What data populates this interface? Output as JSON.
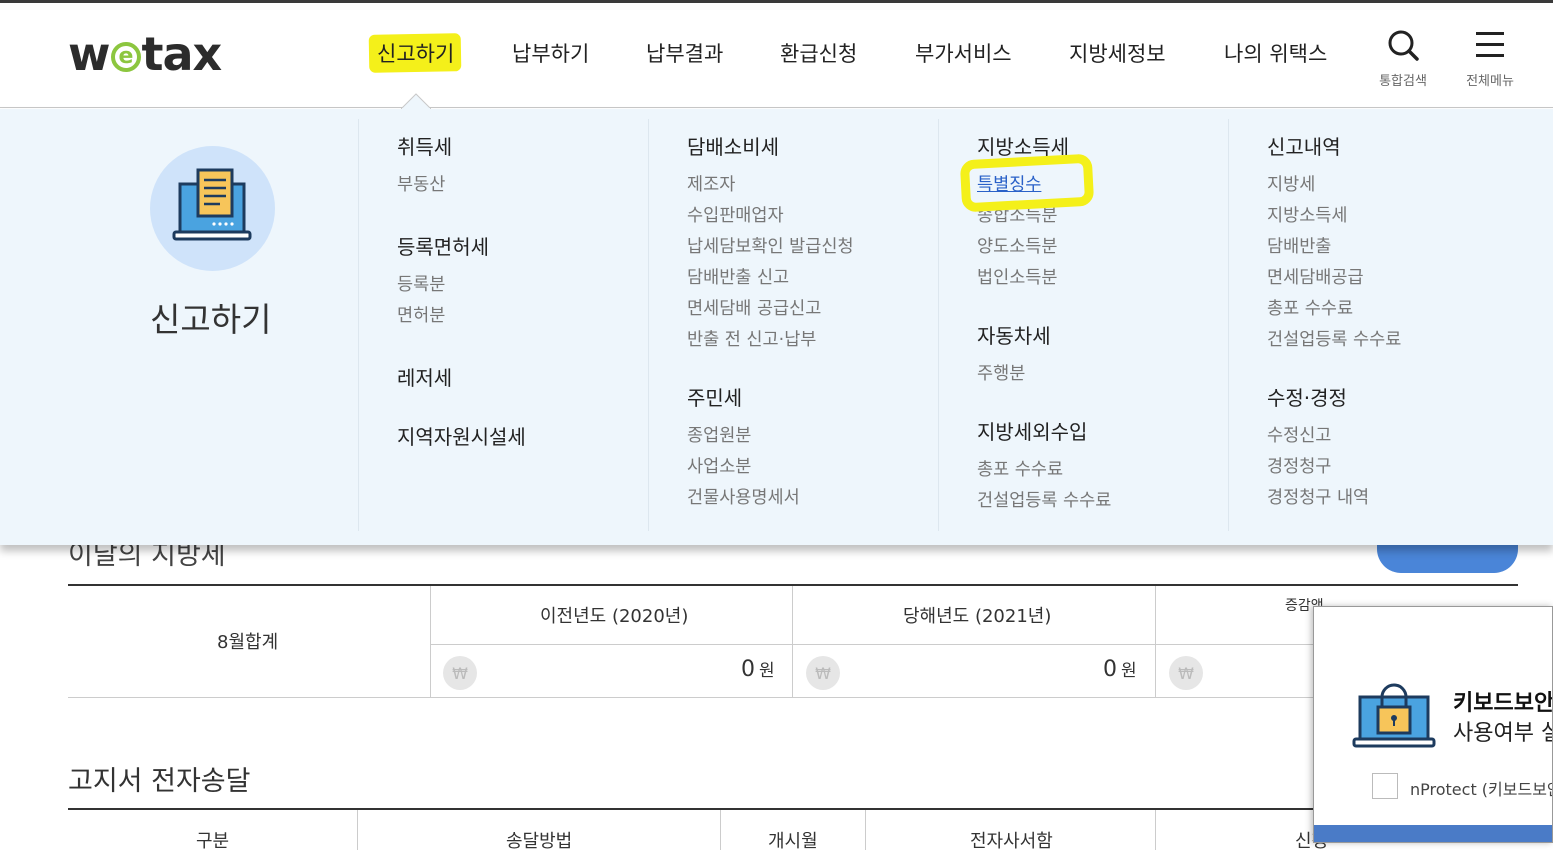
{
  "logo": {
    "w": "w",
    "e": "e",
    "rest": "tax"
  },
  "gnb": [
    {
      "label": "신고하기"
    },
    {
      "label": "납부하기"
    },
    {
      "label": "납부결과"
    },
    {
      "label": "환급신청"
    },
    {
      "label": "부가서비스"
    },
    {
      "label": "지방세정보"
    },
    {
      "label": "나의 위택스"
    }
  ],
  "util": {
    "search_label": "통합검색",
    "menu_label": "전체메뉴"
  },
  "panel": {
    "title": "신고하기",
    "col1": {
      "g1_title": "취득세",
      "g1_items": [
        "부동산"
      ],
      "g2_title": "등록면허세",
      "g2_items": [
        "등록분",
        "면허분"
      ],
      "g3_title": "레저세",
      "g4_title": "지역자원시설세"
    },
    "col2": {
      "g1_title": "담배소비세",
      "g1_items": [
        "제조자",
        "수입판매업자",
        "납세담보확인 발급신청",
        "담배반출 신고",
        "면세담배 공급신고",
        "반출 전 신고·납부"
      ],
      "g2_title": "주민세",
      "g2_items": [
        "종업원분",
        "사업소분",
        "건물사용명세서"
      ]
    },
    "col3": {
      "g1_title": "지방소득세",
      "g1_items": [
        "특별징수",
        "종합소득분",
        "양도소득분",
        "법인소득분"
      ],
      "g2_title": "자동차세",
      "g2_items": [
        "주행분"
      ],
      "g3_title": "지방세외수입",
      "g3_items": [
        "총포 수수료",
        "건설업등록 수수료"
      ]
    },
    "col4": {
      "g1_title": "신고내역",
      "g1_items": [
        "지방세",
        "지방소득세",
        "담배반출",
        "면세담배공급",
        "총포 수수료",
        "건설업등록 수수료"
      ],
      "g2_title": "수정·경정",
      "g2_items": [
        "수정신고",
        "경정청구",
        "경정청구 내역"
      ]
    }
  },
  "section1": {
    "title_partial": "이달의 지방세",
    "row_label": "8월합계",
    "col_prev": "이전년도 (2020년)",
    "col_curr": "당해년도 (2021년)",
    "col_third_partial": "증감액",
    "prev_amount": "0",
    "curr_amount": "0",
    "unit": "원",
    "won": "₩"
  },
  "section2": {
    "title": "고지서 전자송달",
    "headers": [
      "구분",
      "송달방법",
      "개시월",
      "전자사서함",
      "신청"
    ]
  },
  "popup": {
    "title": "키보드보안",
    "line2": "사용여부 설정",
    "checkbox_label": "nProtect (키보드보안)"
  },
  "colors": {
    "highlight": "#f4f01a",
    "panel_bg": "#eef6fc",
    "link": "#2a61c8",
    "accent": "#4a85d8"
  }
}
